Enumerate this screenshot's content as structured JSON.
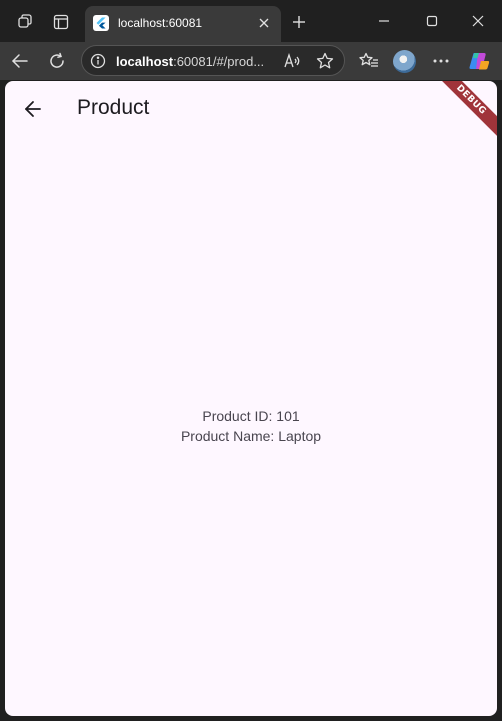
{
  "browser": {
    "tab": {
      "title": "localhost:60081"
    },
    "address": {
      "host": "localhost",
      "path": ":60081/#/prod..."
    }
  },
  "app": {
    "title": "Product",
    "debug_banner": "DEBUG",
    "product": {
      "id_line": "Product ID: 101",
      "name_line": "Product Name: Laptop"
    }
  },
  "icons": {
    "workspaces": "workspaces-icon",
    "tab_actions": "tab-actions-icon",
    "favicon": "flutter-favicon",
    "close": "close-icon",
    "new_tab": "plus-icon",
    "minimize": "minimize-icon",
    "maximize": "maximize-icon",
    "window_close": "close-icon",
    "back": "arrow-left-icon",
    "refresh": "refresh-icon",
    "info": "info-icon",
    "read_aloud": "read-aloud-icon",
    "favorite": "star-icon",
    "favorites": "favorites-icon",
    "more": "more-icon",
    "copilot": "copilot-icon"
  },
  "colors": {
    "chrome_bg": "#202020",
    "toolbar_bg": "#3a3a3a",
    "page_bg": "#fef7ff",
    "debug_banner": "#a0343a"
  }
}
